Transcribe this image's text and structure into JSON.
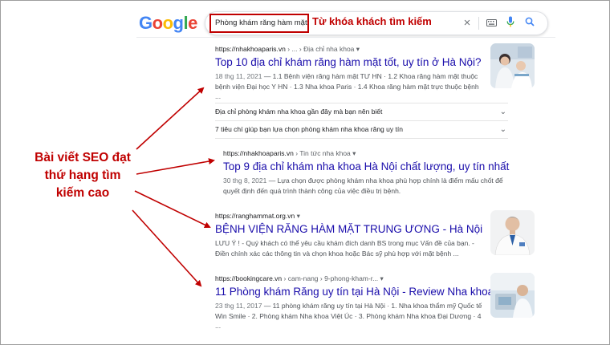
{
  "logo": {
    "letters": [
      "G",
      "o",
      "o",
      "g",
      "l",
      "e"
    ],
    "colors": [
      "#4285F4",
      "#EA4335",
      "#FBBC05",
      "#4285F4",
      "#34A853",
      "#EA4335"
    ]
  },
  "search": {
    "query": "Phòng khám răng hàm mặt",
    "annotation": "Từ khóa khách tìm kiếm",
    "icons": [
      "close-icon",
      "keyboard-icon",
      "microphone-icon",
      "search-icon"
    ]
  },
  "annotation_left": "Bài viết SEO đạt thứ hạng tìm kiếm cao",
  "accent_color": "#c00000",
  "results": [
    {
      "cite": "https://nhakhoaparis.vn",
      "breadcrumb": " › ... › Địa chỉ nha khoa",
      "title": "Top 10 địa chỉ khám răng hàm mặt tốt, uy tín ở Hà Nội?",
      "date": "18 thg 11, 2021",
      "snippet": " — 1.1 Bệnh viện răng hàm mặt TƯ HN · 1.2 Khoa răng hàm mặt thuộc bệnh viện Đại học Y HN · 1.3 Nha khoa Paris · 1.4 Khoa răng hàm mặt trực thuộc bệnh ..."
    },
    {
      "cite": "https://nhakhoaparis.vn",
      "breadcrumb": " › Tin tức nha khoa",
      "title": "Top 9 địa chỉ khám nha khoa Hà Nội chất lượng, uy tín nhất",
      "date": "30 thg 8, 2021",
      "snippet": " — Lựa chọn được phòng khám nha khoa phù hợp chính là điểm mấu chốt để quyết định đến quá trình thành công của việc điều trị bệnh."
    },
    {
      "cite": "https://ranghammat.org.vn",
      "breadcrumb": "",
      "title": "BỆNH VIỆN RĂNG HÀM MẶT TRUNG ƯƠNG - Hà Nội",
      "date": "",
      "snippet": "LƯU Ý ! - Quý khách có thể yêu cầu khám đích danh BS trong mục Vấn đề của bạn. - Điền chính xác các thông tin và chọn khoa hoặc Bác sỹ phù hợp với mặt bệnh ..."
    },
    {
      "cite": "https://bookingcare.vn",
      "breadcrumb": " › cam-nang › 9-phong-kham-r...",
      "title": "11 Phòng khám Răng uy tín tại Hà Nội - Review Nha khoa",
      "date": "23 thg 11, 2017",
      "snippet": " — 11 phòng khám răng uy tín tại Hà Nội · 1. Nha khoa thẩm mỹ Quốc tế Win Smile · 2. Phòng khám Nha khoa Việt Úc · 3. Phòng khám Nha khoa Đại Dương · 4 ..."
    }
  ],
  "faq": [
    "Địa chỉ phòng khám nha khoa gần đây mà bạn nên biết",
    "7 tiêu chí giúp bạn lựa chọn phòng khám nha khoa răng uy tín"
  ]
}
